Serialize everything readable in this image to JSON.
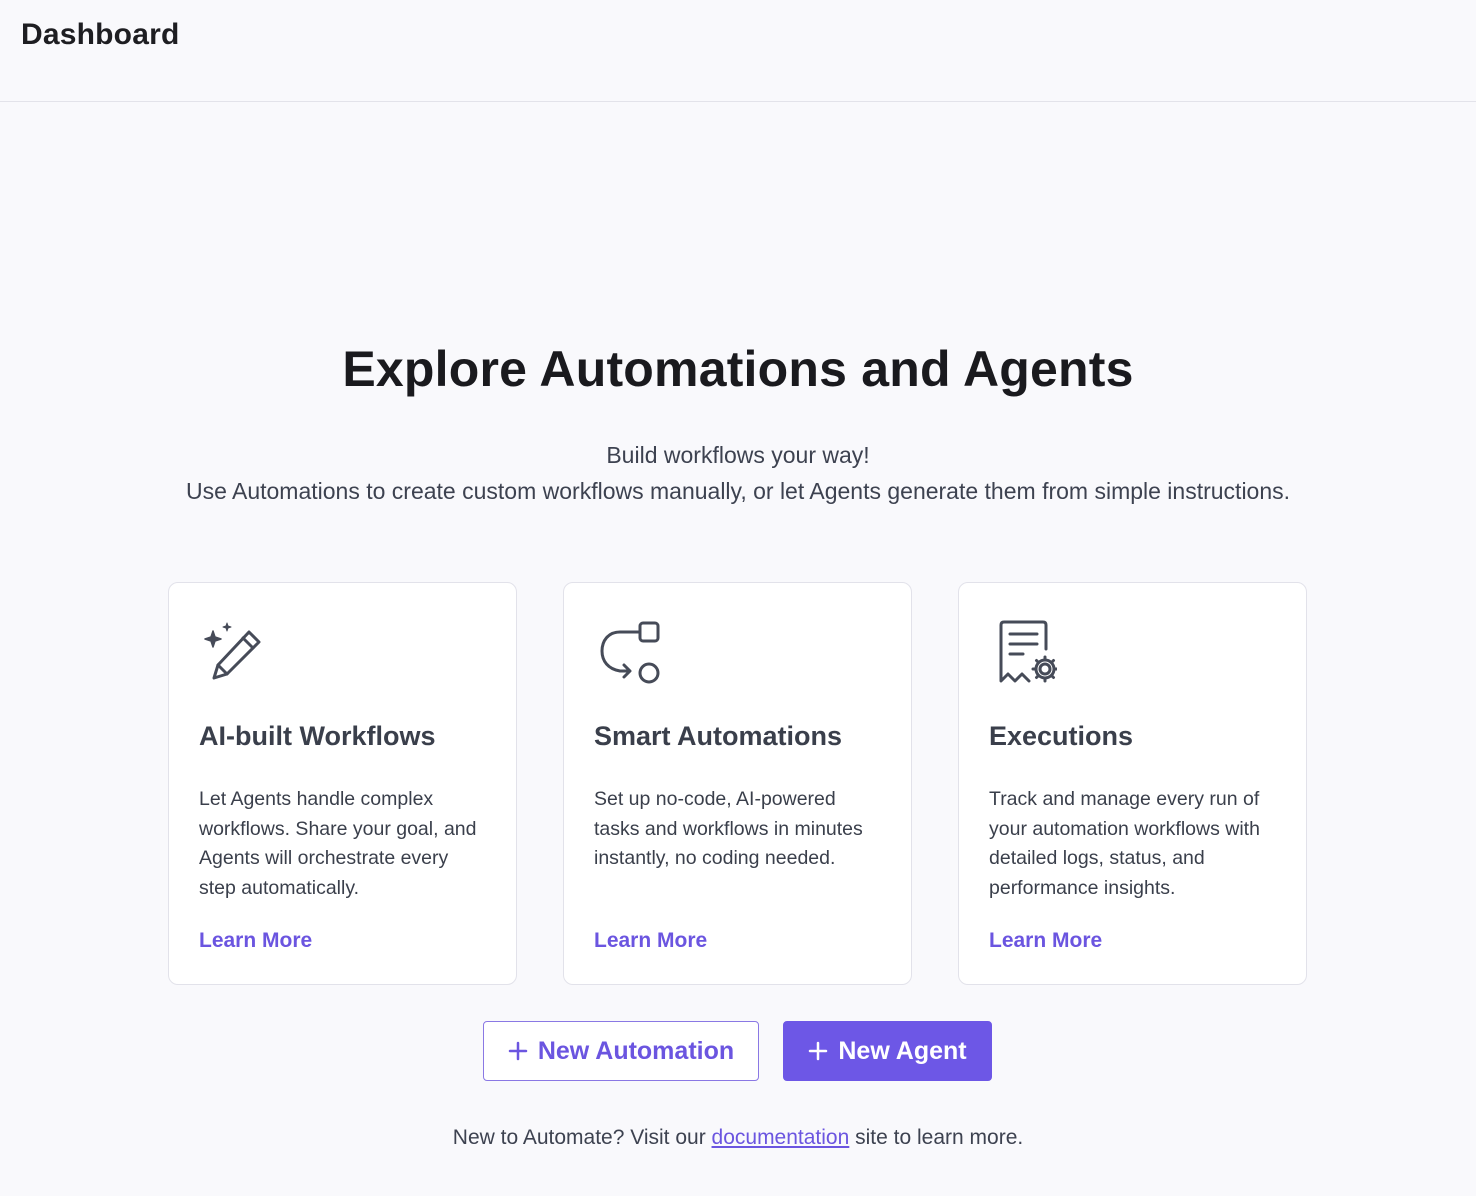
{
  "header": {
    "title": "Dashboard"
  },
  "hero": {
    "title": "Explore Automations and Agents",
    "subtitle_line1": "Build workflows your way!",
    "subtitle_line2": "Use Automations to create custom workflows manually, or let Agents generate them from simple instructions."
  },
  "cards": [
    {
      "icon": "magic-pencil-icon",
      "title": "AI-built Workflows",
      "description": "Let Agents handle complex workflows. Share your goal, and Agents will orchestrate every step automatically.",
      "link": "Learn More"
    },
    {
      "icon": "workflow-flow-icon",
      "title": "Smart Automations",
      "description": "Set up no-code, AI-powered tasks and workflows in minutes instantly, no coding needed.",
      "link": "Learn More"
    },
    {
      "icon": "receipt-settings-icon",
      "title": "Executions",
      "description": "Track and manage every run of your automation workflows with detailed logs, status, and performance insights.",
      "link": "Learn More"
    }
  ],
  "actions": {
    "new_automation": "New Automation",
    "new_agent": "New Agent"
  },
  "footer": {
    "prefix": "New to Automate? Visit our ",
    "link": "documentation",
    "suffix": " site to learn more."
  },
  "colors": {
    "accent": "#6d57e6",
    "link": "#6b55e0",
    "background": "#f9f9fc",
    "text": "#3a3f4b"
  }
}
